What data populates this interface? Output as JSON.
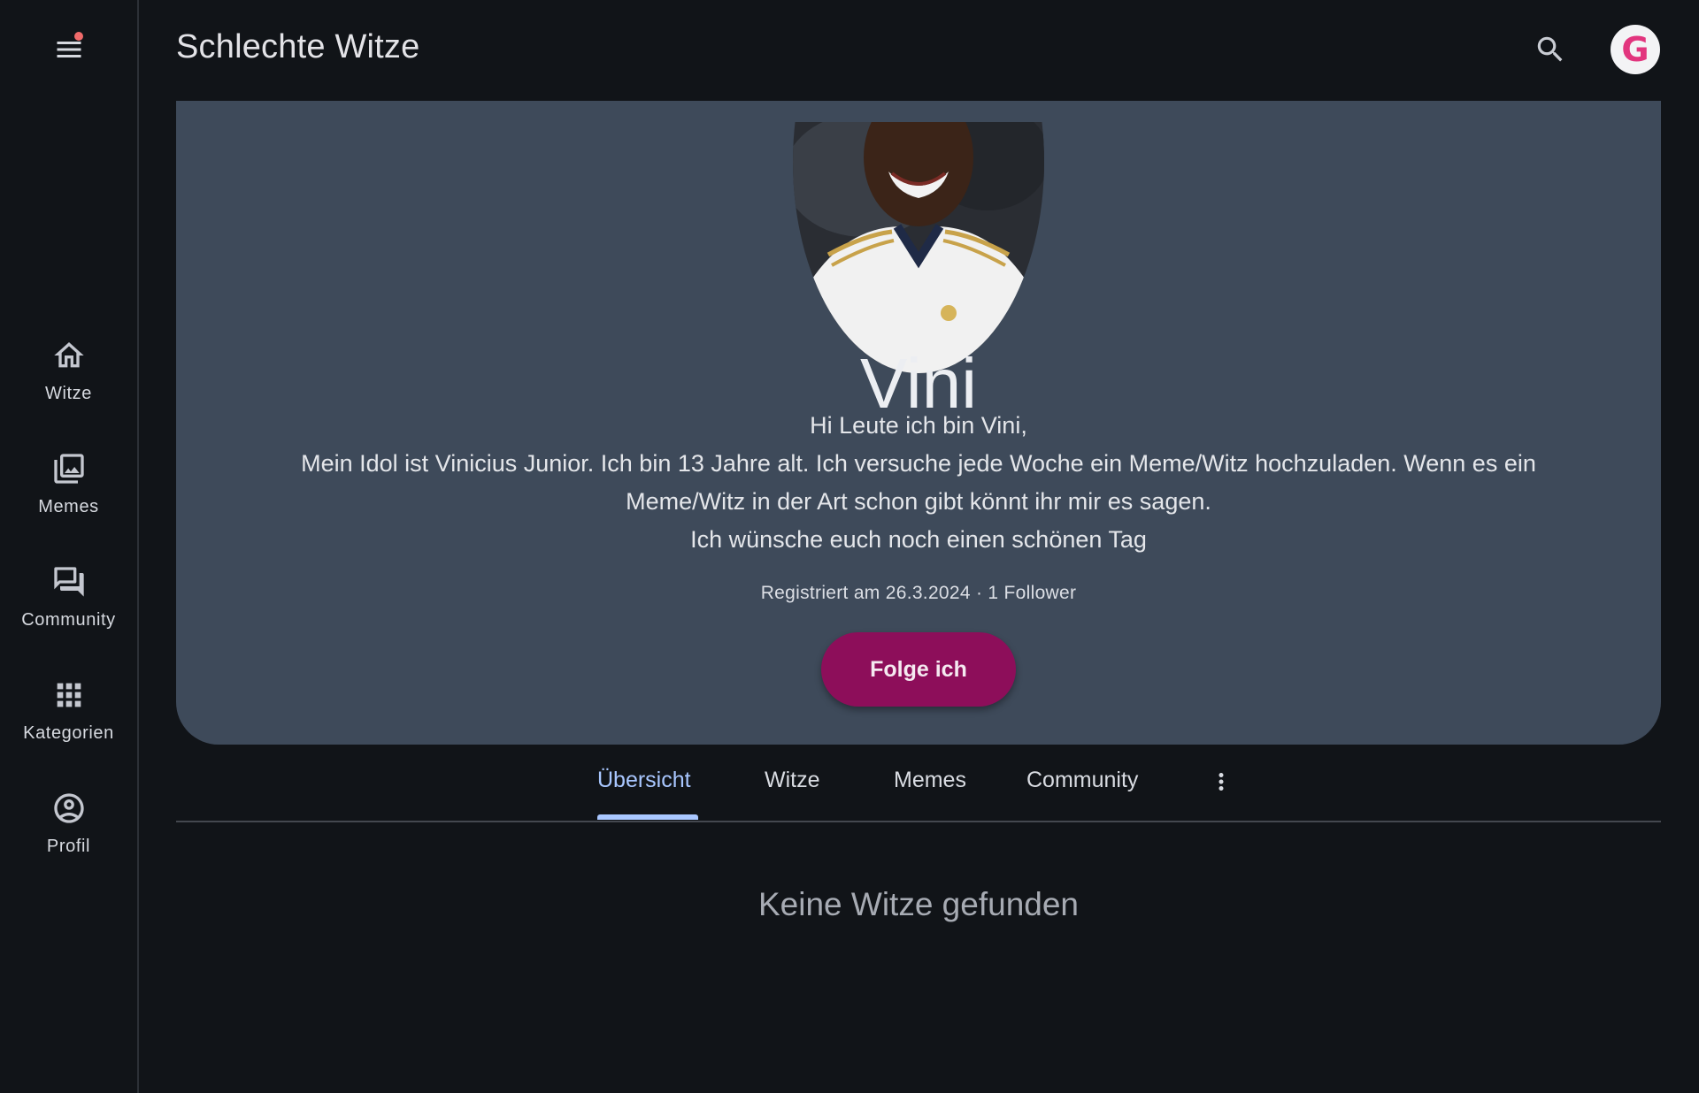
{
  "app": {
    "title": "Schlechte Witze",
    "notification_dot_color": "#f06a6a"
  },
  "sidebar": {
    "items": [
      {
        "label": "Witze",
        "icon": "home-icon"
      },
      {
        "label": "Memes",
        "icon": "photo-library-icon"
      },
      {
        "label": "Community",
        "icon": "forum-icon"
      },
      {
        "label": "Kategorien",
        "icon": "apps-grid-icon"
      },
      {
        "label": "Profil",
        "icon": "account-circle-icon"
      }
    ]
  },
  "header": {
    "search_icon": "search-icon",
    "account_avatar_letter": "G"
  },
  "profile": {
    "name": "Vini",
    "bio_lines": [
      "Hi Leute ich bin Vini,",
      "Mein Idol ist Vinicius Junior. Ich bin 13 Jahre alt. Ich versuche jede Woche ein Meme/Witz hochzuladen. Wenn es ein",
      "Meme/Witz in der Art schon gibt könnt ihr mir es sagen.",
      "Ich wünsche euch noch einen schönen Tag"
    ],
    "meta": "Registriert am 26.3.2024 · 1 Follower",
    "follow_label": "Folge ich",
    "follow_color": "#8d0e5a"
  },
  "tabs": {
    "items": [
      {
        "label": "Übersicht",
        "active": true
      },
      {
        "label": "Witze",
        "active": false
      },
      {
        "label": "Memes",
        "active": false
      },
      {
        "label": "Community",
        "active": false
      }
    ],
    "more_icon": "more-vert-icon",
    "active_color": "#a9c7ff"
  },
  "content": {
    "empty_message": "Keine Witze gefunden"
  }
}
